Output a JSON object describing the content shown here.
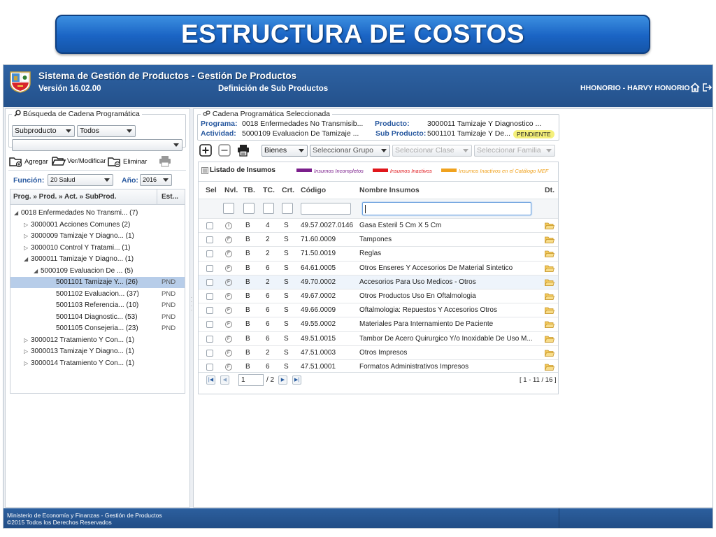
{
  "slide_title": "ESTRUCTURA DE COSTOS",
  "app": {
    "name": "Sistema de Gestión de Productos - Gestión De Productos",
    "version": "Versión 16.02.00",
    "module": "Definición de Sub Productos",
    "user": "HHONORIO - HARVY HONORIO"
  },
  "search": {
    "legend": "Búsqueda de Cadena Programática",
    "filter1": "Subproducto",
    "filter2": "Todos",
    "text_value": ""
  },
  "actions": {
    "add": "Agregar",
    "edit": "Ver/Modificar",
    "delete": "Eliminar"
  },
  "filters": {
    "function_label": "Función:",
    "function_value": "20 Salud",
    "year_label": "Año:",
    "year_value": "2016"
  },
  "tree": {
    "header_col1": "Prog. » Prod. » Act. » SubProd.",
    "header_col2": "Est...",
    "rows": [
      {
        "indent": 0,
        "toggle": "▲",
        "text": "0018 Enfermedades No Transmi... (7)",
        "status": ""
      },
      {
        "indent": 1,
        "toggle": "▷",
        "text": "3000001 Acciones Comunes (2)",
        "status": ""
      },
      {
        "indent": 1,
        "toggle": "▷",
        "text": "3000009 Tamizaje Y Diagno... (1)",
        "status": ""
      },
      {
        "indent": 1,
        "toggle": "▷",
        "text": "3000010 Control Y Tratami... (1)",
        "status": ""
      },
      {
        "indent": 1,
        "toggle": "▲",
        "text": "3000011 Tamizaje Y Diagno... (1)",
        "status": ""
      },
      {
        "indent": 2,
        "toggle": "▲",
        "text": "5000109 Evaluacion De ... (5)",
        "status": ""
      },
      {
        "indent": 3,
        "toggle": "",
        "text": "5001101 Tamizaje Y... (26)",
        "status": "PND",
        "selected": true
      },
      {
        "indent": 3,
        "toggle": "",
        "text": "5001102 Evaluacion... (37)",
        "status": "PND"
      },
      {
        "indent": 3,
        "toggle": "",
        "text": "5001103 Referencia... (10)",
        "status": "PND"
      },
      {
        "indent": 3,
        "toggle": "",
        "text": "5001104 Diagnostic... (53)",
        "status": "PND"
      },
      {
        "indent": 3,
        "toggle": "",
        "text": "5001105 Consejeria... (23)",
        "status": "PND"
      },
      {
        "indent": 1,
        "toggle": "▷",
        "text": "3000012 Tratamiento Y Con... (1)",
        "status": ""
      },
      {
        "indent": 1,
        "toggle": "▷",
        "text": "3000013 Tamizaje Y Diagno... (1)",
        "status": ""
      },
      {
        "indent": 1,
        "toggle": "▷",
        "text": "3000014 Tratamiento Y Con... (1)",
        "status": ""
      }
    ]
  },
  "cadena": {
    "legend": "Cadena Programática Seleccionada",
    "programa_label": "Programa:",
    "programa_value": "0018 Enfermedades No Transmisib...",
    "actividad_label": "Actividad:",
    "actividad_value": "5000109 Evaluacion De Tamizaje ...",
    "producto_label": "Producto:",
    "producto_value": "3000011 Tamizaje Y Diagnostico ...",
    "subproducto_label": "Sub Producto:",
    "subproducto_value": "5001101 Tamizaje Y De...",
    "estado": "PENDIENTE"
  },
  "toolbar": {
    "tipo": "Bienes",
    "grupo": "Seleccionar Grupo",
    "clase": "Seleccionar Clase",
    "familia": "Seleccionar Familia"
  },
  "insumos": {
    "title": "Listado de Insumos",
    "legend": [
      {
        "label": "Insumos Incompletos",
        "color": "#7b1f8c"
      },
      {
        "label": "Insumos Inactivos",
        "color": "#e0161b"
      },
      {
        "label": "Insumos Inactivos en el Catálogo MEF",
        "color": "#f0a21e"
      }
    ],
    "columns": {
      "sel": "Sel",
      "nvl": "Nvl.",
      "tb": "TB.",
      "tc": "TC.",
      "crt": "Crt.",
      "codigo": "Código",
      "nombre": "Nombre Insumos",
      "dt": "Dt."
    },
    "filter_nombre": "",
    "rows": [
      {
        "nvl": "I",
        "tb": "B",
        "tc": "4",
        "crt": "S",
        "codigo": "49.57.0027.0146",
        "nombre": "Gasa Esteril 5 Cm X 5 Cm"
      },
      {
        "nvl": "F",
        "tb": "B",
        "tc": "2",
        "crt": "S",
        "codigo": "71.60.0009",
        "nombre": "Tampones"
      },
      {
        "nvl": "F",
        "tb": "B",
        "tc": "2",
        "crt": "S",
        "codigo": "71.50.0019",
        "nombre": "Reglas"
      },
      {
        "nvl": "F",
        "tb": "B",
        "tc": "6",
        "crt": "S",
        "codigo": "64.61.0005",
        "nombre": "Otros Enseres Y Accesorios De Material Sintetico"
      },
      {
        "nvl": "F",
        "tb": "B",
        "tc": "2",
        "crt": "S",
        "codigo": "49.70.0002",
        "nombre": "Accesorios Para Uso Medicos - Otros"
      },
      {
        "nvl": "F",
        "tb": "B",
        "tc": "6",
        "crt": "S",
        "codigo": "49.67.0002",
        "nombre": "Otros Productos Uso En Oftalmologia"
      },
      {
        "nvl": "F",
        "tb": "B",
        "tc": "6",
        "crt": "S",
        "codigo": "49.66.0009",
        "nombre": "Oftalmologia: Repuestos Y Accesorios Otros"
      },
      {
        "nvl": "F",
        "tb": "B",
        "tc": "6",
        "crt": "S",
        "codigo": "49.55.0002",
        "nombre": "Materiales Para Internamiento De Paciente"
      },
      {
        "nvl": "F",
        "tb": "B",
        "tc": "6",
        "crt": "S",
        "codigo": "49.51.0015",
        "nombre": "Tambor De Acero Quirurgico Y/o Inoxidable De Uso M..."
      },
      {
        "nvl": "F",
        "tb": "B",
        "tc": "2",
        "crt": "S",
        "codigo": "47.51.0003",
        "nombre": "Otros Impresos"
      },
      {
        "nvl": "F",
        "tb": "B",
        "tc": "6",
        "crt": "S",
        "codigo": "47.51.0001",
        "nombre": "Formatos Administrativos Impresos"
      }
    ],
    "pager": {
      "page": "1",
      "total": "/ 2",
      "range": "[ 1 - 11 / 16 ]"
    }
  },
  "footer": {
    "line1": "Ministerio de Economía y Finanzas - Gestión de Productos",
    "line2": "©2015 Todos los Derechos Reservados"
  },
  "colors": {
    "header_blue": "#24518b",
    "selected_row": "#b7cde9",
    "pendiente_badge": "#f5f07a"
  }
}
